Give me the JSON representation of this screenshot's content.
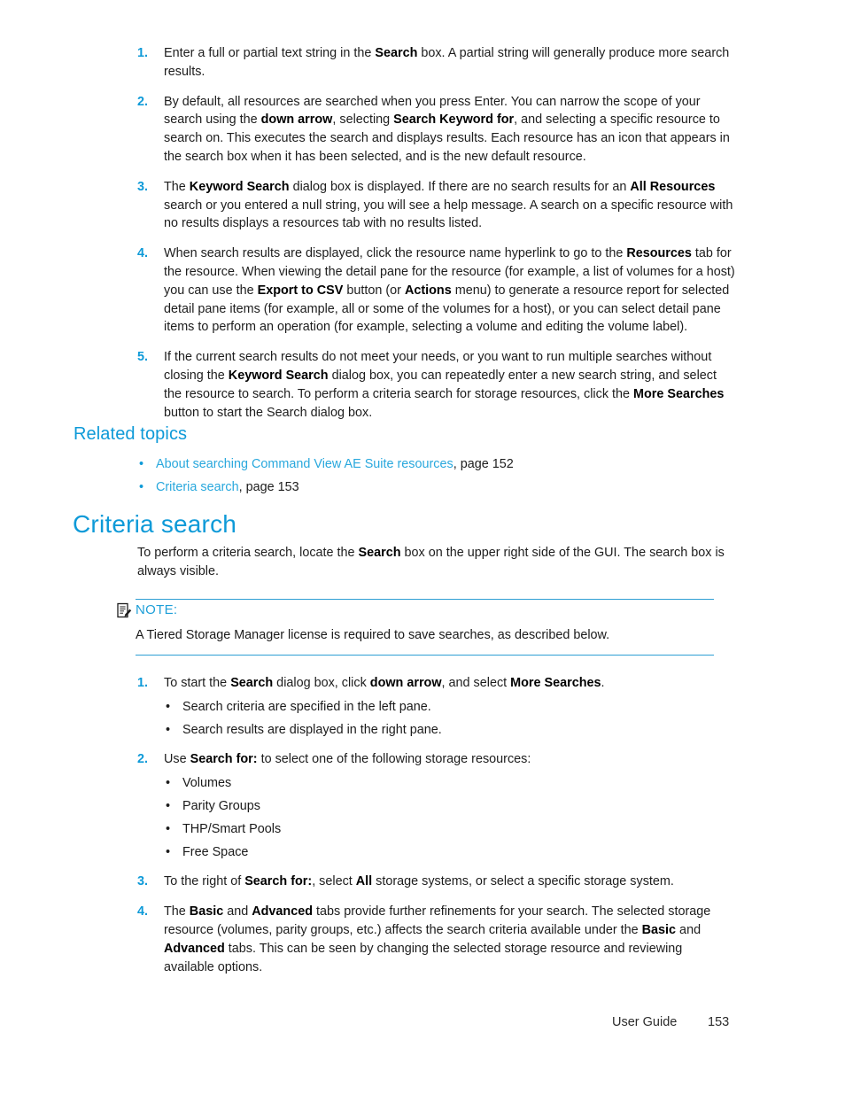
{
  "page": {
    "footer_label": "User Guide",
    "page_number": "153"
  },
  "colors": {
    "accent": "#0e9ad8",
    "link": "#29a8dd",
    "rule": "#2e9fd4",
    "text": "#1d1d1d"
  },
  "top_steps": [
    {
      "num": "1.",
      "parts": [
        {
          "t": "Enter a full or partial text string in the ",
          "b": false
        },
        {
          "t": "Search",
          "b": true
        },
        {
          "t": " box. A partial string will generally produce more search results.",
          "b": false
        }
      ]
    },
    {
      "num": "2.",
      "parts": [
        {
          "t": "By default, all resources are searched when you press Enter. You can narrow the scope of your search using the ",
          "b": false
        },
        {
          "t": "down arrow",
          "b": true
        },
        {
          "t": ", selecting ",
          "b": false
        },
        {
          "t": "Search Keyword for",
          "b": true
        },
        {
          "t": ", and selecting a specific resource to search on. This executes the search and displays results. Each resource has an icon that appears in the search box when it has been selected, and is the new default resource.",
          "b": false
        }
      ]
    },
    {
      "num": "3.",
      "parts": [
        {
          "t": "The ",
          "b": false
        },
        {
          "t": "Keyword Search",
          "b": true
        },
        {
          "t": " dialog box is displayed. If there are no search results for an ",
          "b": false
        },
        {
          "t": "All Resources",
          "b": true
        },
        {
          "t": " search or you entered a null string, you will see a help message. A search on a specific resource with no results displays a resources tab with no results listed.",
          "b": false
        }
      ]
    },
    {
      "num": "4.",
      "parts": [
        {
          "t": "When search results are displayed, click the resource name hyperlink to go to the ",
          "b": false
        },
        {
          "t": "Resources",
          "b": true
        },
        {
          "t": " tab for the resource. When viewing the detail pane for the resource (for example, a list of volumes for a host) you can use the ",
          "b": false
        },
        {
          "t": "Export to CSV",
          "b": true
        },
        {
          "t": " button (or ",
          "b": false
        },
        {
          "t": "Actions",
          "b": true
        },
        {
          "t": " menu) to generate a resource report for selected detail pane items (for example, all or some of the volumes for a host), or you can select detail pane items to perform an operation (for example, selecting a volume and editing the volume label).",
          "b": false
        }
      ]
    },
    {
      "num": "5.",
      "parts": [
        {
          "t": "If the current search results do not meet your needs, or you want to run multiple searches without closing the ",
          "b": false
        },
        {
          "t": "Keyword Search",
          "b": true
        },
        {
          "t": " dialog box, you can repeatedly enter a new search string, and select the resource to search. To perform a criteria search for storage resources, click the ",
          "b": false
        },
        {
          "t": "More Searches",
          "b": true
        },
        {
          "t": " button to start the Search dialog box.",
          "b": false
        }
      ]
    }
  ],
  "related_topics": {
    "heading": "Related topics",
    "items": [
      {
        "bullet": "•",
        "link": "About searching Command View AE Suite resources",
        "suffix": ", page 152"
      },
      {
        "bullet": "•",
        "link": "Criteria search",
        "suffix": ", page 153"
      }
    ]
  },
  "criteria_search": {
    "heading": "Criteria search",
    "intro_parts": [
      {
        "t": "To perform a criteria search, locate the ",
        "b": false
      },
      {
        "t": "Search",
        "b": true
      },
      {
        "t": " box on the upper right side of the GUI. The search box is always visible.",
        "b": false
      }
    ]
  },
  "note": {
    "label": "NOTE:",
    "icon": "note-pencil-icon",
    "body": "A Tiered Storage Manager license is required to save searches, as described below."
  },
  "bottom_steps": [
    {
      "num": "1.",
      "parts": [
        {
          "t": "To start the ",
          "b": false
        },
        {
          "t": "Search",
          "b": true
        },
        {
          "t": " dialog box, click ",
          "b": false
        },
        {
          "t": "down arrow",
          "b": true
        },
        {
          "t": ", and select ",
          "b": false
        },
        {
          "t": "More Searches",
          "b": true
        },
        {
          "t": ".",
          "b": false
        }
      ],
      "bullets": [
        "Search criteria are specified in the left pane.",
        "Search results are displayed in the right pane."
      ]
    },
    {
      "num": "2.",
      "parts": [
        {
          "t": "Use ",
          "b": false
        },
        {
          "t": "Search for:",
          "b": true
        },
        {
          "t": " to select one of the following storage resources:",
          "b": false
        }
      ],
      "bullets": [
        "Volumes",
        "Parity Groups",
        "THP/Smart Pools",
        "Free Space"
      ]
    },
    {
      "num": "3.",
      "parts": [
        {
          "t": "To the right of ",
          "b": false
        },
        {
          "t": "Search for:",
          "b": true
        },
        {
          "t": ", select ",
          "b": false
        },
        {
          "t": "All",
          "b": true
        },
        {
          "t": " storage systems, or select a specific storage system.",
          "b": false
        }
      ],
      "bullets": []
    },
    {
      "num": "4.",
      "parts": [
        {
          "t": "The ",
          "b": false
        },
        {
          "t": "Basic",
          "b": true
        },
        {
          "t": " and ",
          "b": false
        },
        {
          "t": "Advanced",
          "b": true
        },
        {
          "t": " tabs provide further refinements for your search. The selected storage resource (volumes, parity groups, etc.) affects the search criteria available under the ",
          "b": false
        },
        {
          "t": "Basic",
          "b": true
        },
        {
          "t": " and ",
          "b": false
        },
        {
          "t": "Advanced",
          "b": true
        },
        {
          "t": " tabs. This can be seen by changing the selected storage resource and reviewing available options.",
          "b": false
        }
      ],
      "bullets": []
    }
  ]
}
